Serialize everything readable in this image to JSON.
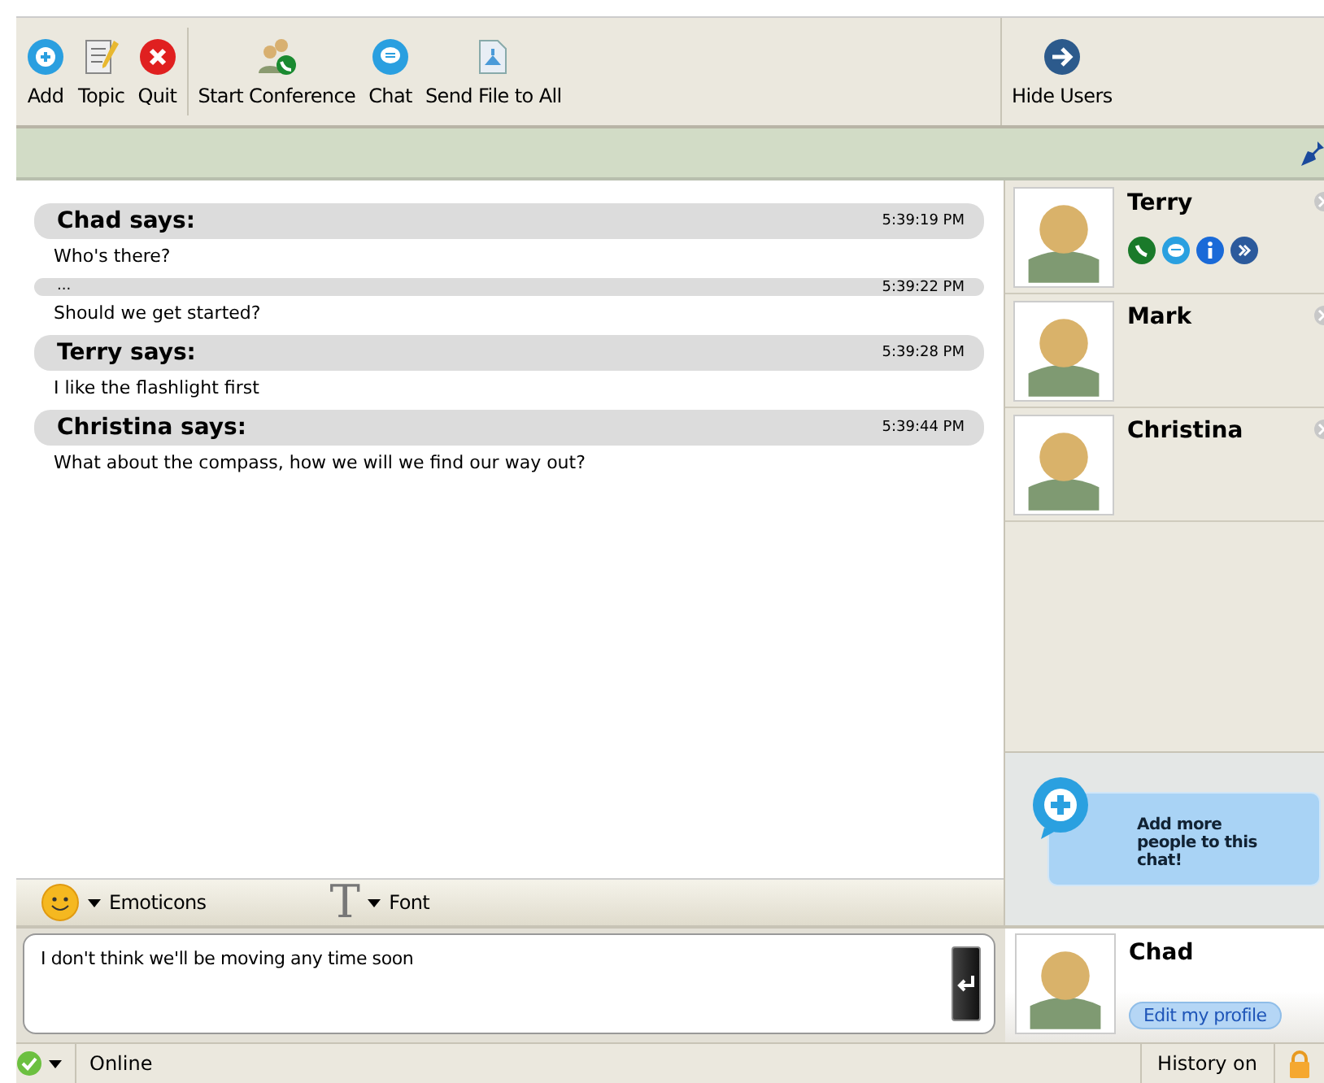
{
  "toolbar": {
    "groups": [
      [
        {
          "kind": "add",
          "label": "Add"
        },
        {
          "kind": "topic",
          "label": "Topic"
        },
        {
          "kind": "quit",
          "label": "Quit"
        }
      ],
      [
        {
          "kind": "conference",
          "label": "Start Conference"
        },
        {
          "kind": "chat",
          "label": "Chat"
        },
        {
          "kind": "file",
          "label": "Send File to All"
        }
      ]
    ],
    "right": {
      "kind": "hide",
      "label": "Hide Users"
    }
  },
  "messages": [
    {
      "kind": "header",
      "sender": "Chad says:",
      "time": "5:39:19 PM",
      "text": "Who's there?"
    },
    {
      "kind": "continuation",
      "sender": "...",
      "time": "5:39:22 PM",
      "text": "Should we get started?"
    },
    {
      "kind": "header",
      "sender": "Terry says:",
      "time": "5:39:28 PM",
      "text": "I like the flashlight first"
    },
    {
      "kind": "header",
      "sender": "Christina says:",
      "time": "5:39:44 PM",
      "text": "What about the compass, how we will we find our way out?"
    }
  ],
  "users": [
    {
      "name": "Terry",
      "expanded": true
    },
    {
      "name": "Mark",
      "expanded": false
    },
    {
      "name": "Christina",
      "expanded": false
    }
  ],
  "add_people": "Add more people to this chat!",
  "format_bar": {
    "emoticons": "Emoticons",
    "font_glyph": "T",
    "font": "Font"
  },
  "input": {
    "value": "I don't think we'll be moving any time soon"
  },
  "profile": {
    "name": "Chad",
    "edit": "Edit my profile"
  },
  "status_bar": {
    "status": "Online",
    "history": "History on"
  }
}
